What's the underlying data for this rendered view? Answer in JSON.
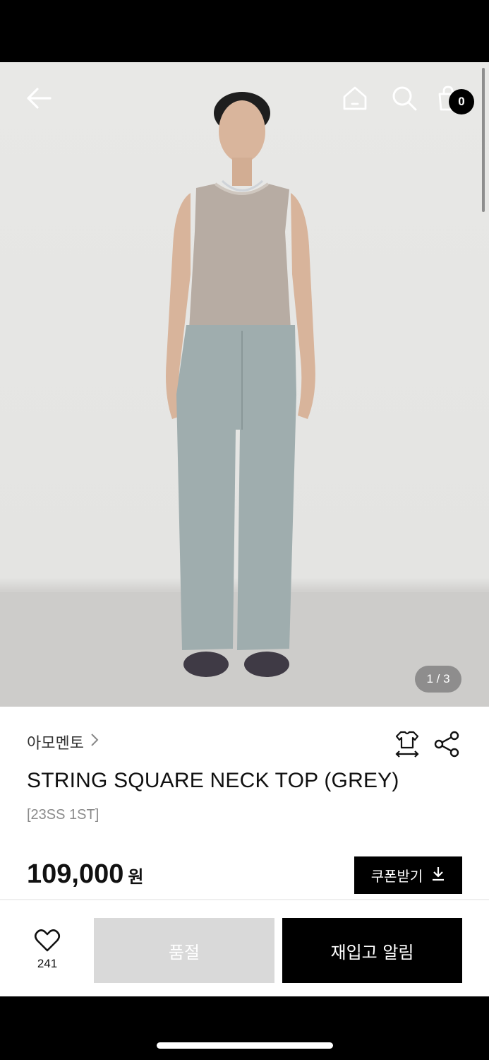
{
  "gallery": {
    "pager_text": "1 / 3"
  },
  "header": {
    "cart_count": "0"
  },
  "product": {
    "brand": "아모멘토",
    "title": "STRING SQUARE NECK TOP (GREY)",
    "code": "[23SS 1ST]",
    "price": "109,000",
    "currency": "원",
    "coupon_label": "쿠폰받기"
  },
  "bottom_bar": {
    "wish_count": "241",
    "soldout_label": "품절",
    "restock_label": "재입고 알림"
  },
  "icons": [
    "back-arrow-icon",
    "home-icon",
    "search-icon",
    "shopping-bag-icon",
    "size-guide-icon",
    "share-icon",
    "download-icon",
    "heart-icon"
  ]
}
